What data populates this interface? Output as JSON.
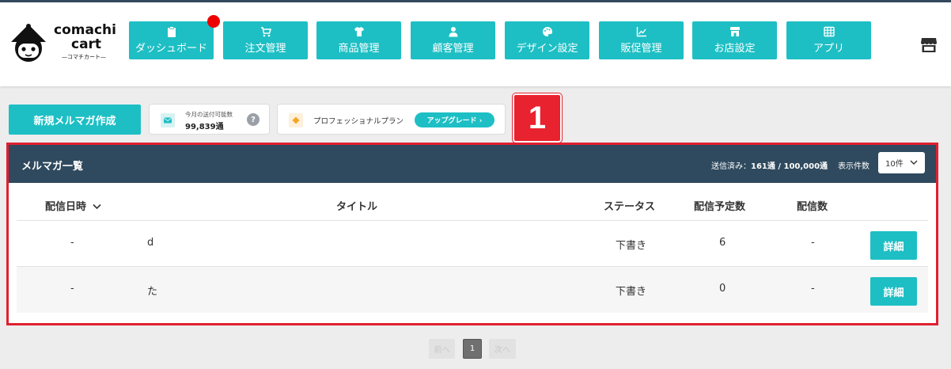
{
  "brand": {
    "name_line1": "comachi",
    "name_line2": "cart",
    "tagline": "—コマチカート—"
  },
  "nav": [
    {
      "label": "ダッシュボード",
      "icon": "clipboard-icon"
    },
    {
      "label": "注文管理",
      "icon": "cart-icon"
    },
    {
      "label": "商品管理",
      "icon": "tshirt-icon"
    },
    {
      "label": "顧客管理",
      "icon": "user-icon"
    },
    {
      "label": "デザイン設定",
      "icon": "palette-icon"
    },
    {
      "label": "販促管理",
      "icon": "chart-line-icon"
    },
    {
      "label": "お店設定",
      "icon": "store-icon"
    },
    {
      "label": "アプリ",
      "icon": "grid-icon"
    }
  ],
  "toolbar": {
    "new_button": "新規メルマガ作成",
    "quota_label": "今月の送付可能数",
    "quota_value": "99,839通",
    "help": "?",
    "plan_label": "プロフェッショナルプラン",
    "upgrade_label": "アップグレード ›"
  },
  "callout": "1",
  "panel": {
    "title": "メルマガ一覧",
    "sent_prefix": "送信済み：",
    "sent_value": "161通 / 100,000通",
    "per_page_label": "表示件数",
    "per_page_value": "10件"
  },
  "table": {
    "headers": [
      "配信日時",
      "タイトル",
      "ステータス",
      "配信予定数",
      "配信数"
    ],
    "rows": [
      {
        "date": "-",
        "title": "d",
        "status": "下書き",
        "scheduled": "6",
        "delivered": "-",
        "action": "詳細"
      },
      {
        "date": "-",
        "title": "た",
        "status": "下書き",
        "scheduled": "0",
        "delivered": "-",
        "action": "詳細"
      }
    ]
  },
  "pagination": {
    "prev": "前へ",
    "current": "1",
    "next": "次へ"
  },
  "colors": {
    "accent": "#1dbfc4",
    "header_bar": "#2f4a5e",
    "highlight": "#e02030",
    "badge": "#ee0000"
  }
}
